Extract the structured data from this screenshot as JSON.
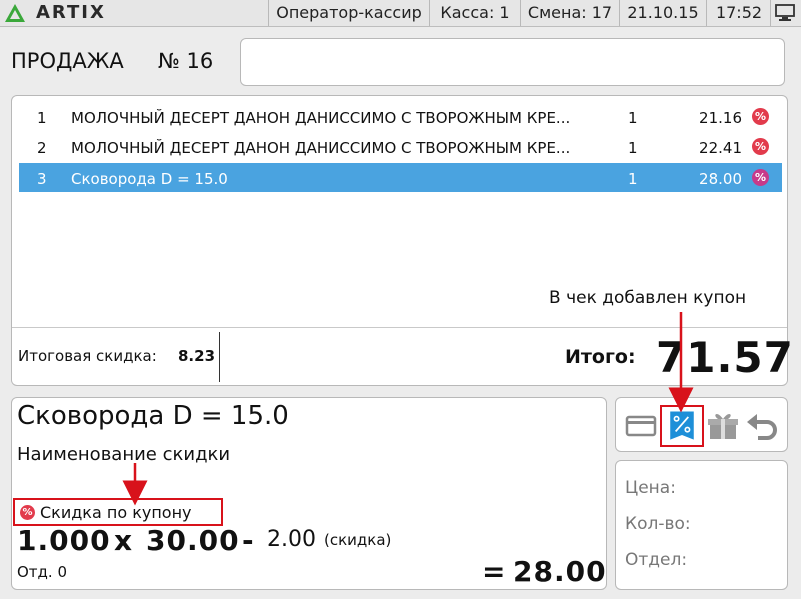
{
  "topbar": {
    "logo": "ARTIX",
    "operator": "Оператор-кассир",
    "register": "Касса: 1",
    "shift": "Смена: 17",
    "date": "21.10.15",
    "time": "17:52",
    "desktop_icon": "desktop-icon"
  },
  "sale": {
    "title": "ПРОДАЖА",
    "number": "№ 16",
    "input_value": ""
  },
  "receipt": {
    "items": [
      {
        "num": "1",
        "name": "МОЛОЧНЫЙ ДЕСЕРТ ДАНОН ДАНИССИМО С ТВОРОЖНЫМ КРЕ...",
        "qty": "1",
        "price": "21.16",
        "discount_icon": "%"
      },
      {
        "num": "2",
        "name": "МОЛОЧНЫЙ ДЕСЕРТ ДАНОН ДАНИССИМО С ТВОРОЖНЫМ КРЕ...",
        "qty": "1",
        "price": "22.41",
        "discount_icon": "%"
      },
      {
        "num": "3",
        "name": "Сковорода D = 15.0",
        "qty": "1",
        "price": "28.00",
        "discount_icon": "%"
      }
    ],
    "selected_index": 2,
    "annotation": "В чек добавлен купон",
    "total_discount_label": "Итоговая скидка:",
    "total_discount_value": "8.23",
    "total_label": "Итого:",
    "total_value": "71.57"
  },
  "item": {
    "name": "Сковорода D = 15.0",
    "discount_heading": "Наименование скидки",
    "coupon_icon": "%",
    "coupon_label": "Скидка по купону",
    "qty": "1.000",
    "times": "x",
    "price": "30.00",
    "minus": "-",
    "discount": "2.00",
    "discount_note": "(скидка)",
    "dept": "Отд. 0",
    "eq": "=",
    "result": "28.00"
  },
  "info": {
    "price_label": "Цена:",
    "qty_label": "Кол-во:",
    "dept_label": "Отдел:"
  },
  "colors": {
    "selected_row": "#4aa3e0",
    "discount_badge": "#e23b4c",
    "highlight_red": "#d8121b",
    "discount_button": "#1e8fd8"
  }
}
